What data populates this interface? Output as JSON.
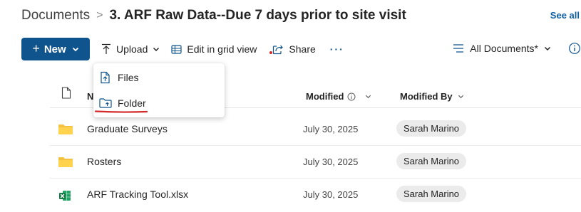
{
  "breadcrumb": {
    "root": "Documents",
    "separator": ">",
    "current": "3. ARF Raw Data--Due 7 days prior to site visit"
  },
  "see_all": "See all",
  "toolbar": {
    "new_label": "New",
    "upload_label": "Upload",
    "grid_label": "Edit in grid view",
    "share_label": "Share",
    "more_label": "···",
    "view_label": "All Documents*"
  },
  "upload_menu": {
    "items": [
      {
        "label": "Files",
        "icon": "file-upload-icon"
      },
      {
        "label": "Folder",
        "icon": "folder-upload-icon"
      }
    ]
  },
  "table": {
    "columns": {
      "name": "N",
      "modified": "Modified",
      "modified_by": "Modified By"
    },
    "rows": [
      {
        "name": "Graduate Surveys",
        "type": "folder",
        "modified": "July 30, 2025",
        "modified_by": "Sarah Marino"
      },
      {
        "name": "Rosters",
        "type": "folder",
        "modified": "July 30, 2025",
        "modified_by": "Sarah Marino"
      },
      {
        "name": "ARF Tracking Tool.xlsx",
        "type": "excel",
        "modified": "July 30, 2025",
        "modified_by": "Sarah Marino"
      }
    ]
  },
  "colors": {
    "accent": "#0f548c",
    "folder": "#f5c142",
    "excel": "#107c41",
    "annotation_red": "#d42a2a"
  }
}
